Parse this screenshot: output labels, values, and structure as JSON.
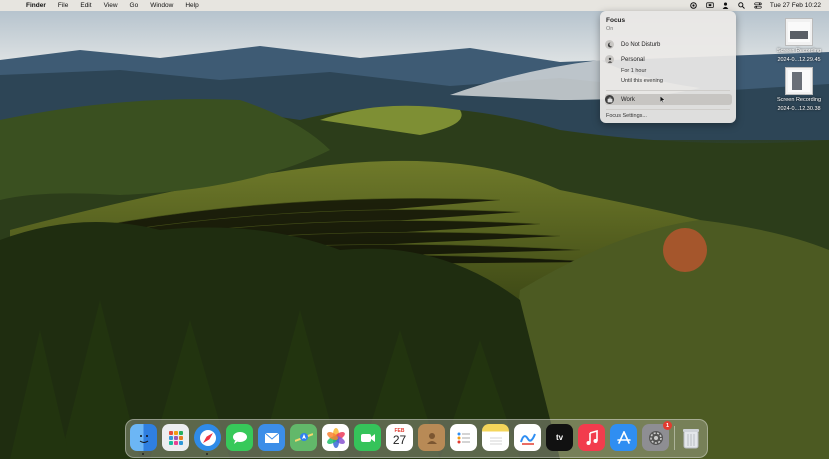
{
  "menubar": {
    "apple_glyph": "",
    "items": [
      {
        "label": "Finder",
        "bold": true
      },
      {
        "label": "File"
      },
      {
        "label": "Edit"
      },
      {
        "label": "View"
      },
      {
        "label": "Go"
      },
      {
        "label": "Window"
      },
      {
        "label": "Help"
      }
    ],
    "status_icons": [
      "focus-icon",
      "screen-mirroring-icon",
      "user-icon",
      "search-icon",
      "control-center-icon"
    ],
    "clock": "Tue 27 Feb 10:22"
  },
  "focus_panel": {
    "title": "Focus",
    "status": "On",
    "options": [
      {
        "label": "Do Not Disturb",
        "icon": "moon-icon"
      },
      {
        "label": "Personal",
        "icon": "person-icon"
      },
      {
        "label": "For 1 hour"
      },
      {
        "label": "Until this evening"
      },
      {
        "label": "Work",
        "icon": "briefcase-icon",
        "selected": true
      }
    ],
    "settings_label": "Focus Settings..."
  },
  "desktop_files": [
    {
      "name": "Screen Recording",
      "date": "2024-0...12.29.45"
    },
    {
      "name": "Screen Recording",
      "date": "2024-0...12.30.38"
    }
  ],
  "dock": {
    "apps": [
      {
        "name": "Finder",
        "icon": "finder-icon",
        "color": "#3f8fe8",
        "running": true
      },
      {
        "name": "Launchpad",
        "icon": "launchpad-icon",
        "color": "#ecedef"
      },
      {
        "name": "Safari",
        "icon": "safari-icon",
        "color": "#2f8be8",
        "running": true
      },
      {
        "name": "Messages",
        "icon": "messages-icon",
        "color": "#37c95a"
      },
      {
        "name": "Mail",
        "icon": "mail-icon",
        "color": "#3c8ee8"
      },
      {
        "name": "Maps",
        "icon": "maps-icon",
        "color": "#62b86a"
      },
      {
        "name": "Photos",
        "icon": "photos-icon",
        "color": "#ffffff"
      },
      {
        "name": "FaceTime",
        "icon": "facetime-icon",
        "color": "#35c35a"
      },
      {
        "name": "Calendar",
        "icon": "calendar-icon",
        "color": "#ffffff",
        "month": "FEB",
        "day": "27"
      },
      {
        "name": "Contacts",
        "icon": "contacts-icon",
        "color": "#b88a56"
      },
      {
        "name": "Reminders",
        "icon": "reminders-icon",
        "color": "#ffffff"
      },
      {
        "name": "Notes",
        "icon": "notes-icon",
        "color": "#f4d65a"
      },
      {
        "name": "Freeform",
        "icon": "freeform-icon",
        "color": "#ffffff"
      },
      {
        "name": "TV",
        "icon": "tv-icon",
        "color": "#111111",
        "label": "tv"
      },
      {
        "name": "Music",
        "icon": "music-icon",
        "color": "#f23c4d"
      },
      {
        "name": "App Store",
        "icon": "appstore-icon",
        "color": "#2f8ef2"
      },
      {
        "name": "System Settings",
        "icon": "settings-icon",
        "color": "#8e8e93",
        "badge": "1"
      },
      {
        "name": "Trash",
        "icon": "trash-icon",
        "color": "#d9dde2"
      }
    ]
  }
}
